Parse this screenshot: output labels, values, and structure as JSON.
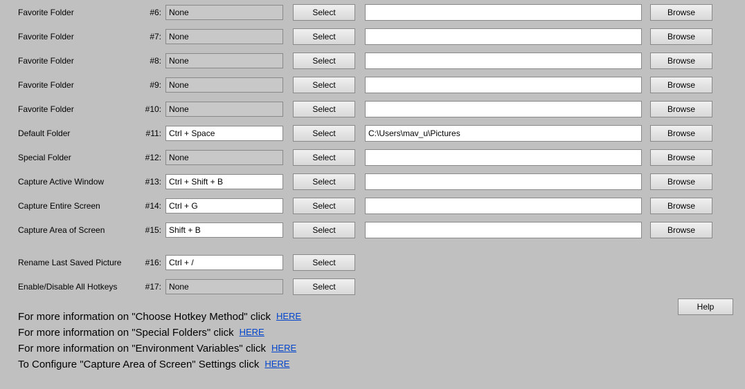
{
  "rows": [
    {
      "label": "Favorite Folder",
      "num": "#6:",
      "hotkey": "None",
      "gray": true,
      "path": "",
      "browse": true
    },
    {
      "label": "Favorite Folder",
      "num": "#7:",
      "hotkey": "None",
      "gray": true,
      "path": "",
      "browse": true
    },
    {
      "label": "Favorite Folder",
      "num": "#8:",
      "hotkey": "None",
      "gray": true,
      "path": "",
      "browse": true
    },
    {
      "label": "Favorite Folder",
      "num": "#9:",
      "hotkey": "None",
      "gray": true,
      "path": "",
      "browse": true
    },
    {
      "label": "Favorite Folder",
      "num": "#10:",
      "hotkey": "None",
      "gray": true,
      "path": "",
      "browse": true
    },
    {
      "label": "Default Folder",
      "num": "#11:",
      "hotkey": "Ctrl + Space",
      "gray": false,
      "path": "C:\\Users\\mav_u\\Pictures",
      "browse": true
    },
    {
      "label": "Special Folder",
      "num": "#12:",
      "hotkey": "None",
      "gray": true,
      "path": "",
      "browse": true
    },
    {
      "label": "Capture Active Window",
      "num": "#13:",
      "hotkey": "Ctrl + Shift + B",
      "gray": false,
      "path": "",
      "browse": true
    },
    {
      "label": "Capture Entire Screen",
      "num": "#14:",
      "hotkey": "Ctrl + G",
      "gray": false,
      "path": "",
      "browse": true
    },
    {
      "label": "Capture Area of Screen",
      "num": "#15:",
      "hotkey": "Shift + B",
      "gray": false,
      "path": "",
      "browse": true
    },
    {
      "label": "Rename Last Saved Picture",
      "num": "#16:",
      "hotkey": "Ctrl + /",
      "gray": false,
      "path": null,
      "browse": false,
      "spacer": true
    },
    {
      "label": "Enable/Disable All Hotkeys",
      "num": "#17:",
      "hotkey": "None",
      "gray": true,
      "path": null,
      "browse": false
    }
  ],
  "buttons": {
    "select": "Select",
    "browse": "Browse",
    "help": "Help"
  },
  "info": [
    {
      "text": "For more information on \"Choose Hotkey Method\" click",
      "link": "HERE"
    },
    {
      "text": "For more information on \"Special Folders\" click",
      "link": "HERE"
    },
    {
      "text": "For more information on \"Environment Variables\" click",
      "link": "HERE"
    },
    {
      "text": "To Configure \"Capture Area of Screen\" Settings click",
      "link": "HERE"
    }
  ]
}
